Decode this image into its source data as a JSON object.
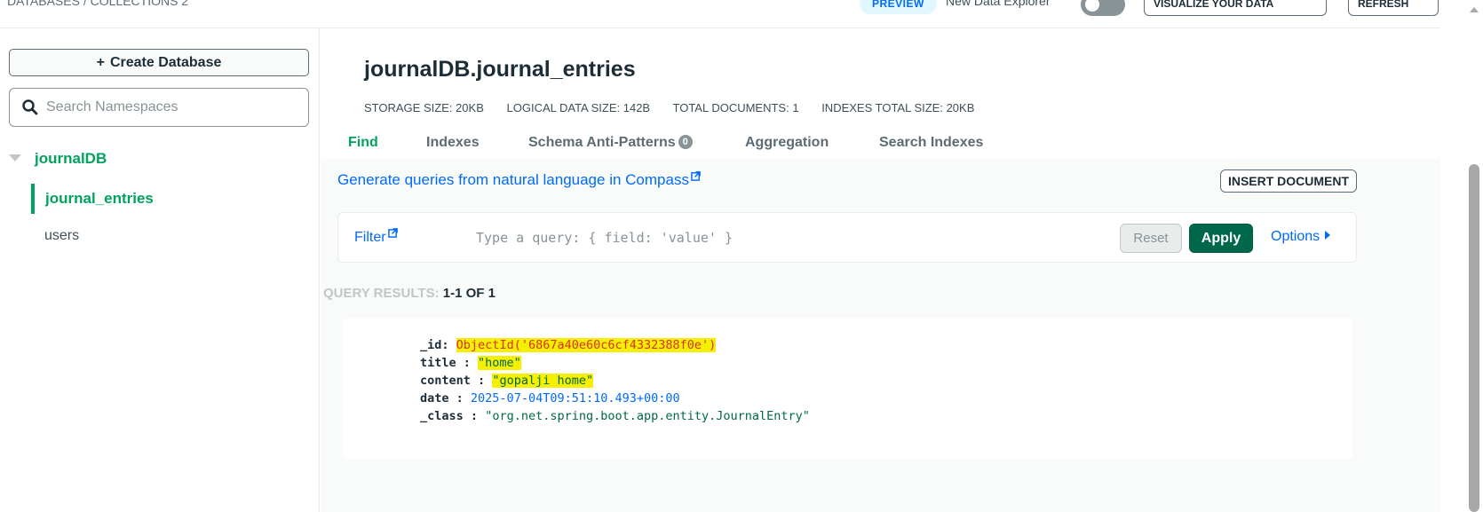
{
  "topbar": {
    "breadcrumb": "DATABASES / COLLECTIONS 2",
    "preview_badge": "PREVIEW",
    "new_data_explorer_label": "New Data Explorer",
    "visualize_label": "VISUALIZE YOUR DATA",
    "refresh_label": "REFRESH"
  },
  "sidebar": {
    "create_database_icon": "+",
    "create_database_label": "Create Database",
    "search_placeholder": "Search Namespaces",
    "database": "journalDB",
    "collections": [
      "journal_entries",
      "users"
    ],
    "active_collection": "journal_entries"
  },
  "main": {
    "namespace": "journalDB.journal_entries",
    "stats": {
      "storage_size": "STORAGE SIZE: 20KB",
      "logical_data_size": "LOGICAL DATA SIZE: 142B",
      "total_documents": "TOTAL DOCUMENTS: 1",
      "indexes_total_size": "INDEXES TOTAL SIZE: 20KB"
    },
    "tabs": [
      {
        "label": "Find",
        "active": true
      },
      {
        "label": "Indexes"
      },
      {
        "label": "Schema Anti-Patterns",
        "badge": "0"
      },
      {
        "label": "Aggregation"
      },
      {
        "label": "Search Indexes"
      }
    ],
    "generate_queries_link": "Generate queries from natural language in Compass",
    "insert_document_label": "INSERT DOCUMENT",
    "query_bar": {
      "filter_label": "Filter",
      "placeholder": "Type a query: { field: 'value' }",
      "reset_label": "Reset",
      "apply_label": "Apply",
      "options_label": "Options"
    },
    "results": {
      "label": "QUERY RESULTS:",
      "range": "1-1 OF 1"
    },
    "document": [
      {
        "key": "_id",
        "sep": ":",
        "value": "ObjectId('6867a40e60c6cf4332388f0e')",
        "type": "oid"
      },
      {
        "key": "title",
        "sep": " :",
        "value": "\"home\"",
        "type": "str"
      },
      {
        "key": "content",
        "sep": " :",
        "value": "\"gopalji home\"",
        "type": "str"
      },
      {
        "key": "date",
        "sep": " :",
        "value": "2025-07-04T09:51:10.493+00:00",
        "type": "date"
      },
      {
        "key": "_class",
        "sep": " :",
        "value": "\"org.net.spring.boot.app.entity.JournalEntry\"",
        "type": "str"
      }
    ]
  },
  "colors": {
    "accent_green": "#00a35c",
    "apply_green": "#00684a",
    "link_blue": "#016bf8",
    "highlight_yellow": "#f5ef00"
  }
}
